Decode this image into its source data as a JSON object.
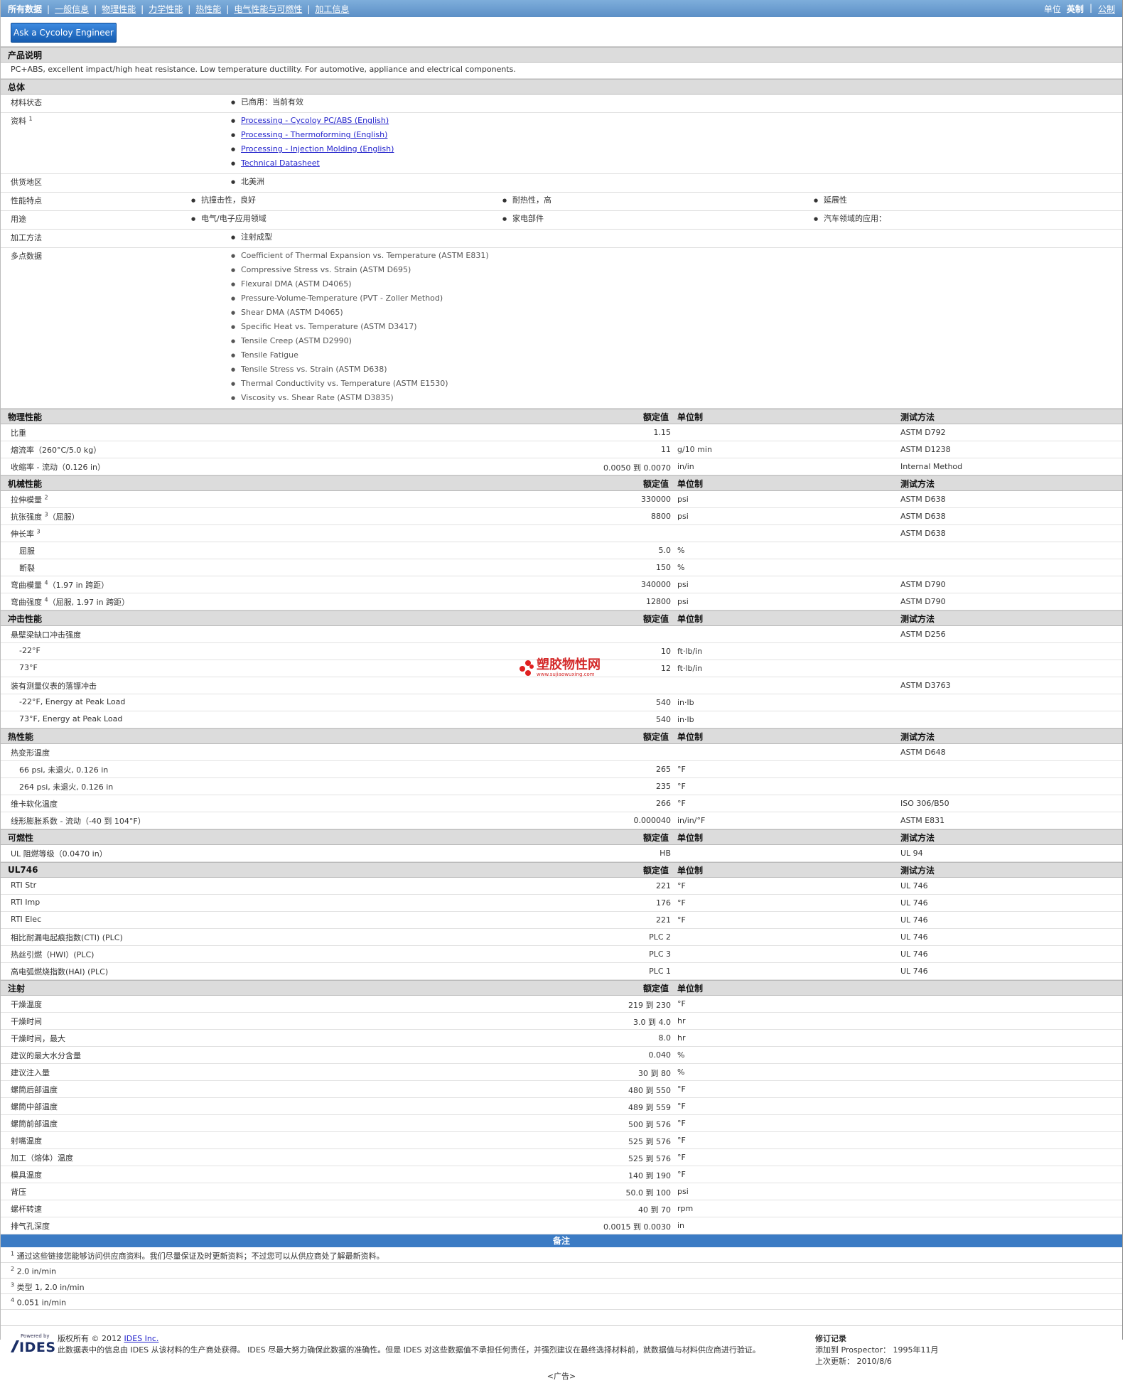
{
  "nav": {
    "tabs": [
      "所有数据",
      "一般信息",
      "物理性能",
      "力学性能",
      "热性能",
      "电气性能与可燃性",
      "加工信息"
    ],
    "units_label": "单位",
    "unit_english": "英制",
    "unit_metric": "公制"
  },
  "ask_button": "Ask a Cycoloy Engineer",
  "product_desc": {
    "heading": "产品说明",
    "text": "PC+ABS, excellent impact/high heat resistance. Low temperature ductility. For automotive, appliance and electrical components."
  },
  "general": {
    "heading": "总体",
    "material_status_label": "材料状态",
    "material_status": "已商用：当前有效",
    "docs_label": "资料",
    "docs_sup": "1",
    "docs": [
      "Processing - Cycoloy PC/ABS (English)",
      "Processing - Thermoforming (English)",
      "Processing - Injection Molding (English)",
      "Technical Datasheet"
    ],
    "supply_label": "供货地区",
    "supply": "北美洲",
    "features_label": "性能特点",
    "features": [
      "抗撞击性，良好",
      "耐热性，高",
      "延展性"
    ],
    "uses_label": "用途",
    "uses": [
      "电气/电子应用领域",
      "家电部件",
      "汽车领域的应用："
    ],
    "process_label": "加工方法",
    "process": "注射成型",
    "multipoint_label": "多点数据",
    "multipoint": [
      "Coefficient of Thermal Expansion vs. Temperature (ASTM E831)",
      "Compressive Stress vs. Strain (ASTM D695)",
      "Flexural DMA (ASTM D4065)",
      "Pressure-Volume-Temperature (PVT - Zoller Method)",
      "Shear DMA (ASTM D4065)",
      "Specific Heat vs. Temperature (ASTM D3417)",
      "Tensile Creep (ASTM D2990)",
      "Tensile Fatigue",
      "Tensile Stress vs. Strain (ASTM D638)",
      "Thermal Conductivity vs. Temperature (ASTM E1530)",
      "Viscosity vs. Shear Rate (ASTM D3835)"
    ]
  },
  "col_headers": {
    "value": "额定值",
    "unit": "单位制",
    "method": "测试方法"
  },
  "sections": [
    {
      "title": "物理性能",
      "methods": true,
      "rows": [
        {
          "label": "比重",
          "value": "1.15",
          "unit": "",
          "method": "ASTM D792"
        },
        {
          "label": "熔流率（260°C/5.0 kg）",
          "value": "11",
          "unit": "g/10 min",
          "method": "ASTM D1238"
        },
        {
          "label": "收缩率 - 流动（0.126 in）",
          "value": "0.0050 到 0.0070",
          "unit": "in/in",
          "method": "Internal Method"
        }
      ]
    },
    {
      "title": "机械性能",
      "methods": true,
      "rows": [
        {
          "label": "拉伸模量",
          "sup": "2",
          "value": "330000",
          "unit": "psi",
          "method": "ASTM D638"
        },
        {
          "label": "抗张强度",
          "sup": "3",
          "suffix": "（屈服）",
          "value": "8800",
          "unit": "psi",
          "method": "ASTM D638"
        },
        {
          "label": "伸长率",
          "sup": "3",
          "value": "",
          "unit": "",
          "method": "ASTM D638"
        },
        {
          "label": "屈服",
          "sub": true,
          "value": "5.0",
          "unit": "%",
          "method": ""
        },
        {
          "label": "断裂",
          "sub": true,
          "value": "150",
          "unit": "%",
          "method": ""
        },
        {
          "label": "弯曲模量",
          "sup": "4",
          "suffix": "（1.97 in 跨距）",
          "value": "340000",
          "unit": "psi",
          "method": "ASTM D790"
        },
        {
          "label": "弯曲强度",
          "sup": "4",
          "suffix": "（屈服, 1.97 in 跨距）",
          "value": "12800",
          "unit": "psi",
          "method": "ASTM D790"
        }
      ]
    },
    {
      "title": "冲击性能",
      "methods": true,
      "rows": [
        {
          "label": "悬壁梁缺口冲击强度",
          "value": "",
          "unit": "",
          "method": "ASTM D256"
        },
        {
          "label": "-22°F",
          "sub": true,
          "value": "10",
          "unit": "ft·lb/in",
          "method": ""
        },
        {
          "label": "73°F",
          "sub": true,
          "value": "12",
          "unit": "ft·lb/in",
          "method": ""
        },
        {
          "label": "装有测量仪表的落镖冲击",
          "value": "",
          "unit": "",
          "method": "ASTM D3763"
        },
        {
          "label": "-22°F, Energy at Peak Load",
          "sub": true,
          "value": "540",
          "unit": "in·lb",
          "method": ""
        },
        {
          "label": "73°F, Energy at Peak Load",
          "sub": true,
          "value": "540",
          "unit": "in·lb",
          "method": ""
        }
      ]
    },
    {
      "title": "热性能",
      "methods": true,
      "rows": [
        {
          "label": "热变形温度",
          "value": "",
          "unit": "",
          "method": "ASTM D648"
        },
        {
          "label": "66 psi, 未退火, 0.126 in",
          "sub": true,
          "value": "265",
          "unit": "°F",
          "method": ""
        },
        {
          "label": "264 psi, 未退火, 0.126 in",
          "sub": true,
          "value": "235",
          "unit": "°F",
          "method": ""
        },
        {
          "label": "维卡软化温度",
          "value": "266",
          "unit": "°F",
          "method": "ISO 306/B50"
        },
        {
          "label": "线形膨胀系数 - 流动（-40 到 104°F）",
          "value": "0.000040",
          "unit": "in/in/°F",
          "method": "ASTM E831"
        }
      ]
    },
    {
      "title": "可燃性",
      "methods": true,
      "rows": [
        {
          "label": "UL 阻燃等级（0.0470 in）",
          "blue": true,
          "value": "HB",
          "unit": "",
          "method": "UL 94"
        }
      ]
    },
    {
      "title": "UL746",
      "methods": true,
      "rows": [
        {
          "label": "RTI Str",
          "blue": true,
          "value": "221",
          "unit": "°F",
          "method": "UL 746"
        },
        {
          "label": "RTI Imp",
          "blue": true,
          "value": "176",
          "unit": "°F",
          "method": "UL 746"
        },
        {
          "label": "RTI Elec",
          "blue": true,
          "value": "221",
          "unit": "°F",
          "method": "UL 746"
        },
        {
          "label": "相比耐漏电起痕指数(CTI) (PLC)",
          "value": "PLC 2",
          "unit": "",
          "method": "UL 746"
        },
        {
          "label": "热丝引燃（HWI）(PLC)",
          "value": "PLC 3",
          "unit": "",
          "method": "UL 746"
        },
        {
          "label": "高电弧燃烧指数(HAI) (PLC)",
          "value": "PLC 1",
          "unit": "",
          "method": "UL 746"
        }
      ]
    },
    {
      "title": "注射",
      "methods": false,
      "rows": [
        {
          "label": "干燥温度",
          "value": "219 到 230",
          "unit": "°F",
          "method": ""
        },
        {
          "label": "干燥时间",
          "value": "3.0 到 4.0",
          "unit": "hr",
          "method": ""
        },
        {
          "label": "干燥时间，最大",
          "value": "8.0",
          "unit": "hr",
          "method": ""
        },
        {
          "label": "建议的最大水分含量",
          "value": "0.040",
          "unit": "%",
          "method": ""
        },
        {
          "label": "建议注入量",
          "value": "30 到 80",
          "unit": "%",
          "method": ""
        },
        {
          "label": "螺筒后部温度",
          "value": "480 到 550",
          "unit": "°F",
          "method": ""
        },
        {
          "label": "螺筒中部温度",
          "value": "489 到 559",
          "unit": "°F",
          "method": ""
        },
        {
          "label": "螺筒前部温度",
          "value": "500 到 576",
          "unit": "°F",
          "method": ""
        },
        {
          "label": "射嘴温度",
          "value": "525 到 576",
          "unit": "°F",
          "method": ""
        },
        {
          "label": "加工（熔体）温度",
          "value": "525 到 576",
          "unit": "°F",
          "method": ""
        },
        {
          "label": "模具温度",
          "value": "140 到 190",
          "unit": "°F",
          "method": ""
        },
        {
          "label": "背压",
          "value": "50.0 到 100",
          "unit": "psi",
          "method": ""
        },
        {
          "label": "螺杆转速",
          "value": "40 到 70",
          "unit": "rpm",
          "method": ""
        },
        {
          "label": "排气孔深度",
          "value": "0.0015 到 0.0030",
          "unit": "in",
          "method": ""
        }
      ]
    }
  ],
  "notes": {
    "heading": "备注",
    "items": [
      {
        "n": "1",
        "text": "通过这些链接您能够访问供应商资料。我们尽量保证及时更新资料；不过您可以从供应商处了解最新资料。"
      },
      {
        "n": "2",
        "text": "2.0 in/min"
      },
      {
        "n": "3",
        "text": "类型  1, 2.0 in/min"
      },
      {
        "n": "4",
        "text": "0.051 in/min"
      }
    ]
  },
  "footer": {
    "powered_by": "Powered by",
    "logo_text": "IDES",
    "copyright_prefix": "版权所有  © 2012",
    "copyright_link": "IDES Inc.",
    "disclaimer": "此数据表中的信息由  IDES 从该材料的生产商处获得。 IDES 尽最大努力确保此数据的准确性。但是  IDES 对这些数据值不承担任何责任，并强烈建议在最终选择材料前，就数据值与材料供应商进行验证。",
    "revision_heading": "修订记录",
    "added_label": "添加到 Prospector：",
    "added_date": "1995年11月",
    "updated_label": "上次更新：",
    "updated_date": "2010/8/6",
    "ad": "<广告>"
  },
  "watermark": {
    "name": "塑胶物性网",
    "url": "www.sujiaowuxing.com"
  }
}
